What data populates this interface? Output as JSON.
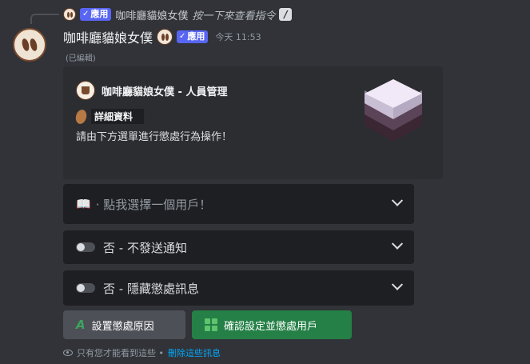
{
  "reply": {
    "bot_name": "咖啡廳貓娘女僕",
    "badge": "應用",
    "command_text": "按一下來查看指令",
    "command_icon": "slash-command-icon"
  },
  "message": {
    "username": "咖啡廳貓娘女僕",
    "badge": "應用",
    "timestamp": "今天 11:53",
    "edited": "(已編輯)"
  },
  "embed": {
    "author": "咖啡廳貓娘女僕 - 人員管理",
    "detail_tag": "詳細資料",
    "description": "請由下方選單進行懲處行為操作！"
  },
  "selects": {
    "user": {
      "icon": "book-icon",
      "placeholder": "· 點我選擇一個用戶！"
    },
    "notify": {
      "icon": "toggle-off-icon",
      "value": "否 - 不發送通知"
    },
    "hide": {
      "icon": "toggle-off-icon",
      "value": "否 - 隱藏懲處訊息"
    }
  },
  "buttons": {
    "reason_label": "設置懲處原因",
    "confirm_label": "確認設定並懲處用戶"
  },
  "ephemeral": {
    "text": "只有您才能看到這些 •",
    "dismiss": "刪除這些訊息"
  },
  "colors": {
    "background": "#313338",
    "embed": "#2b2d31",
    "select": "#1e1f22",
    "badge": "#5865f2",
    "success": "#248046",
    "secondary": "#4e5058",
    "link": "#00a8fc"
  }
}
